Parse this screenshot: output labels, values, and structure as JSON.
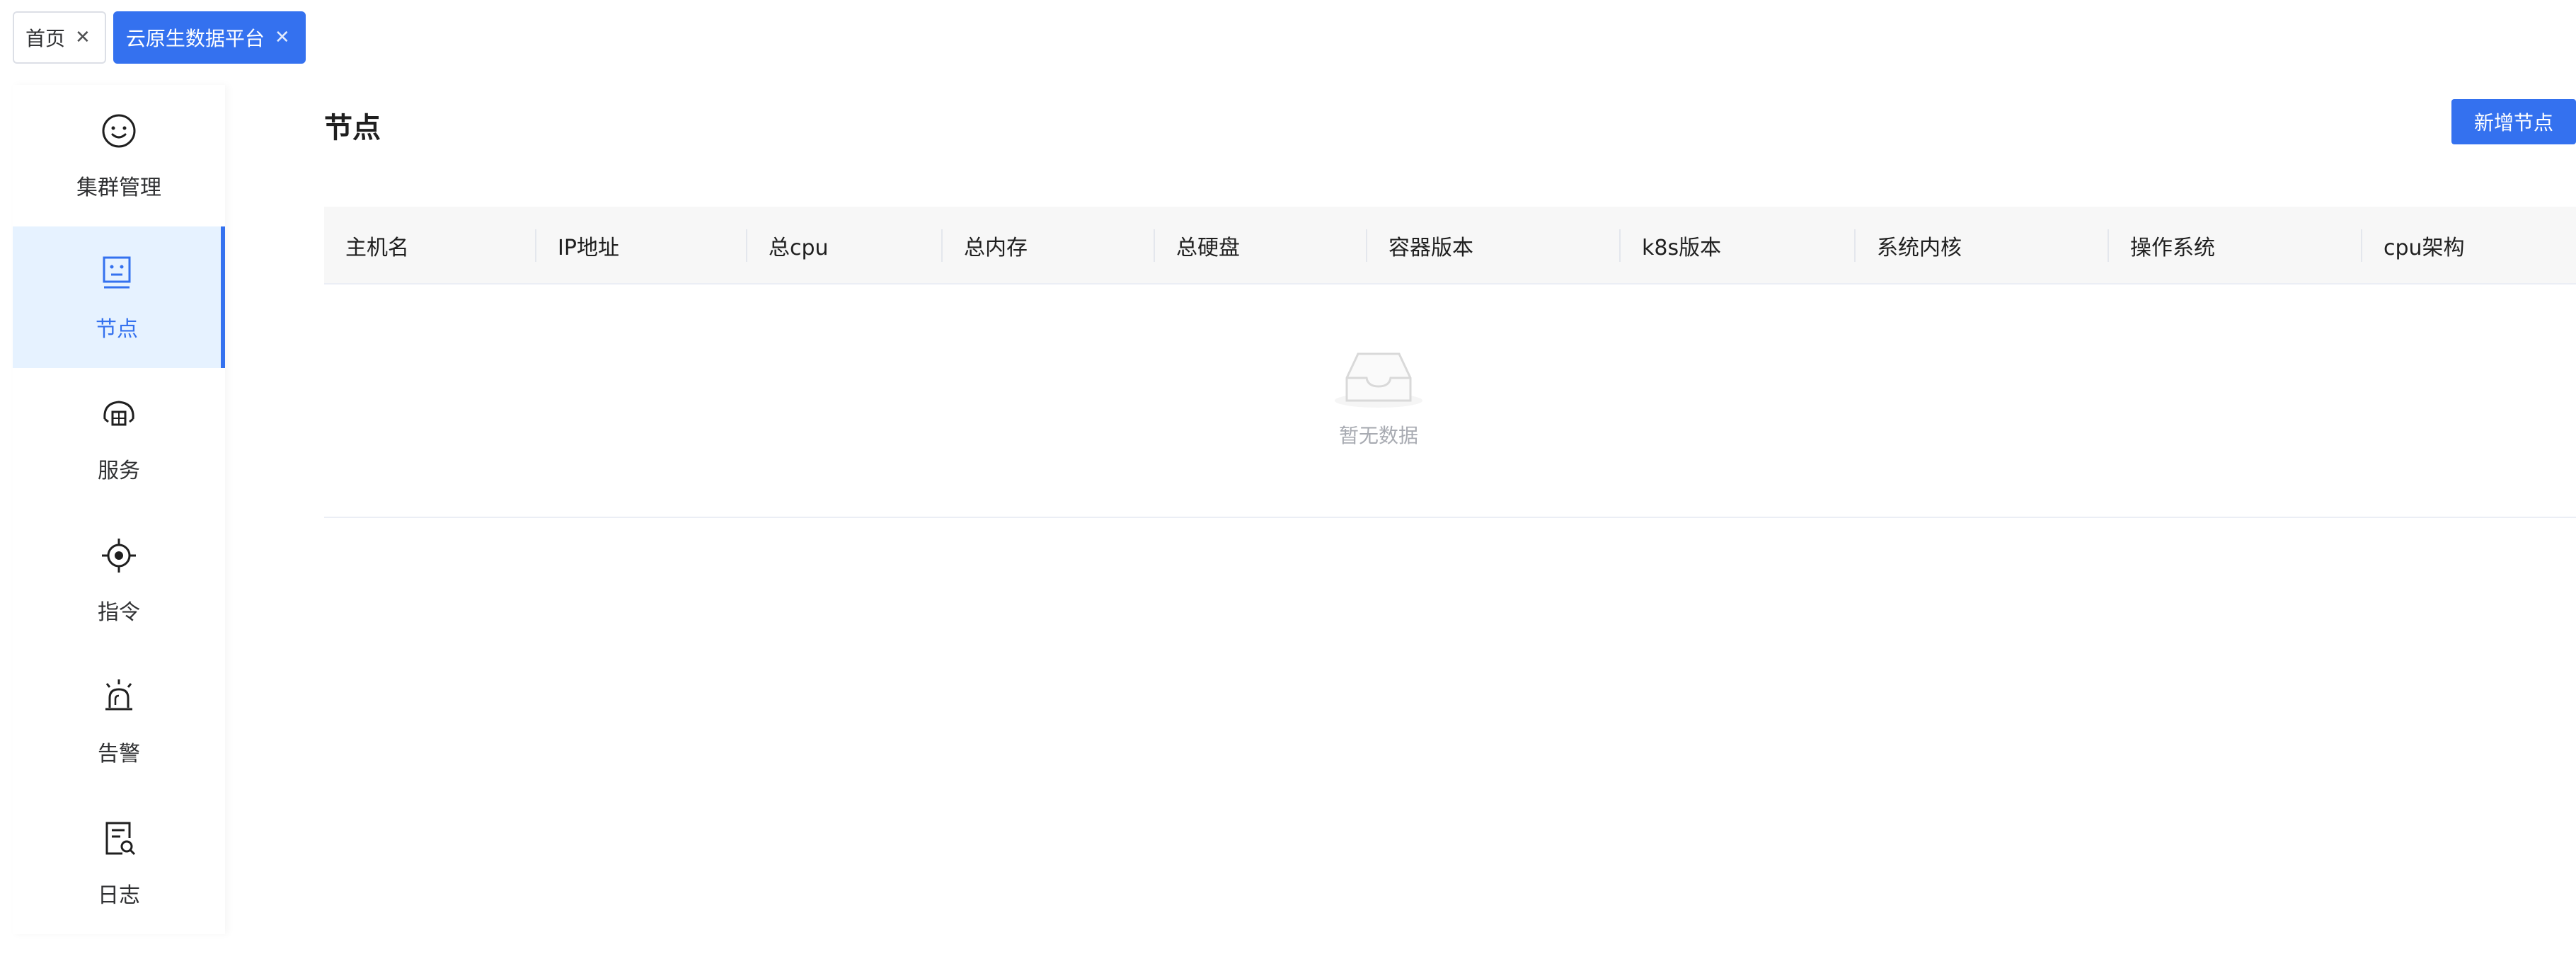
{
  "tabs": [
    {
      "label": "首页",
      "active": false
    },
    {
      "label": "云原生数据平台",
      "active": true
    }
  ],
  "sidebar": {
    "items": [
      {
        "label": "集群管理",
        "icon": "smile-icon",
        "active": false
      },
      {
        "label": "节点",
        "icon": "node-icon",
        "active": true
      },
      {
        "label": "服务",
        "icon": "service-icon",
        "active": false
      },
      {
        "label": "指令",
        "icon": "target-icon",
        "active": false
      },
      {
        "label": "告警",
        "icon": "alarm-icon",
        "active": false
      },
      {
        "label": "日志",
        "icon": "log-search-icon",
        "active": false
      }
    ]
  },
  "main": {
    "title": "节点",
    "add_button": "新增节点",
    "table": {
      "columns": [
        "主机名",
        "IP地址",
        "总cpu",
        "总内存",
        "总硬盘",
        "容器版本",
        "k8s版本",
        "系统内核",
        "操作系统",
        "cpu架构"
      ],
      "rows": [],
      "empty_text": "暂无数据"
    }
  },
  "colors": {
    "accent": "#3471ef",
    "active_nav_bg": "#e6f2ff",
    "header_bg": "#f7f7f7",
    "empty_text": "#a8abb2"
  }
}
